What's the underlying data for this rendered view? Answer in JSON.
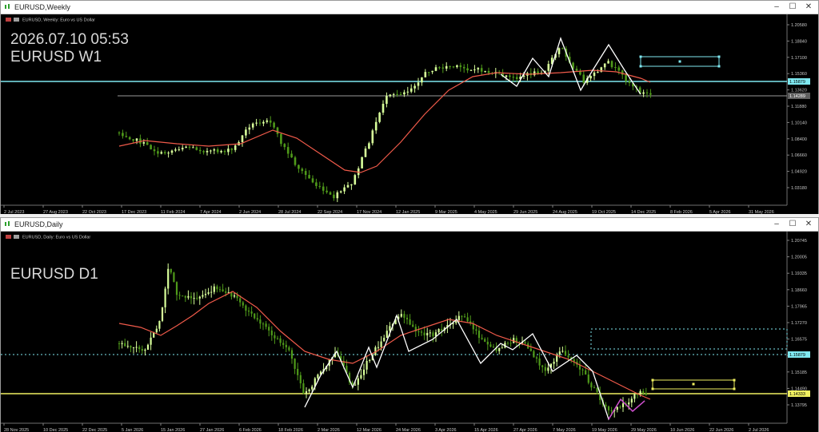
{
  "colors": {
    "bg": "#000000",
    "grid": "#1f1f1f",
    "bull": "#d8ff9a",
    "bear": "#4f9a1a",
    "ma": "#f05a4a",
    "zigzag": "#ffffff",
    "cyan": "#7fe8f0",
    "yellow": "#f0f060",
    "text": "#c8c8c8",
    "magenta": "#d040d0"
  },
  "weekly": {
    "window_title": "EURUSD,Weekly",
    "header": "EURUSD, Weekly:  Euro vs US Dollar",
    "overlay_time": "2026.07.10 05:53",
    "overlay_symbol": "EURUSD W1",
    "price_labels": [
      "1.20580",
      "1.18840",
      "1.17100",
      "1.15360",
      "1.13620",
      "1.11880",
      "1.10140",
      "1.08400",
      "1.06660",
      "1.04920",
      "1.03180"
    ],
    "current_price_label": "1.14289",
    "hline_price_label": "1.15879",
    "date_labels": [
      "2 Jul 2023",
      "27 Aug 2023",
      "22 Oct 2023",
      "17 Dec 2023",
      "11 Feb 2024",
      "7 Apr 2024",
      "2 Jun 2024",
      "28 Jul 2024",
      "22 Sep 2024",
      "17 Nov 2024",
      "12 Jan 2025",
      "9 Mar 2025",
      "4 May 2025",
      "29 Jun 2025",
      "24 Aug 2025",
      "19 Oct 2025",
      "14 Dec 2025",
      "8 Feb 2026",
      "5 Apr 2026",
      "31 May 2026"
    ]
  },
  "daily": {
    "window_title": "EURUSD,Daily",
    "header": "EURUSD, Daily:  Euro vs US Dollar",
    "overlay_symbol": "EURUSD D1",
    "price_labels": [
      "1.20745",
      "1.20005",
      "1.19335",
      "1.18660",
      "1.17965",
      "1.17270",
      "1.16575",
      "1.15880",
      "1.15185",
      "1.14490",
      "1.13795"
    ],
    "current_price_label": "1.14333",
    "hline_price_label": "1.15879",
    "date_labels": [
      "28 Nov 2025",
      "10 Dec 2025",
      "22 Dec 2025",
      "5 Jan 2026",
      "15 Jan 2026",
      "27 Jan 2026",
      "6 Feb 2026",
      "18 Feb 2026",
      "2 Mar 2026",
      "12 Mar 2026",
      "24 Mar 2026",
      "3 Apr 2026",
      "15 Apr 2026",
      "27 Apr 2026",
      "7 May 2026",
      "19 May 2026",
      "29 May 2026",
      "10 Jun 2026",
      "22 Jun 2026",
      "2 Jul 2026"
    ]
  }
}
